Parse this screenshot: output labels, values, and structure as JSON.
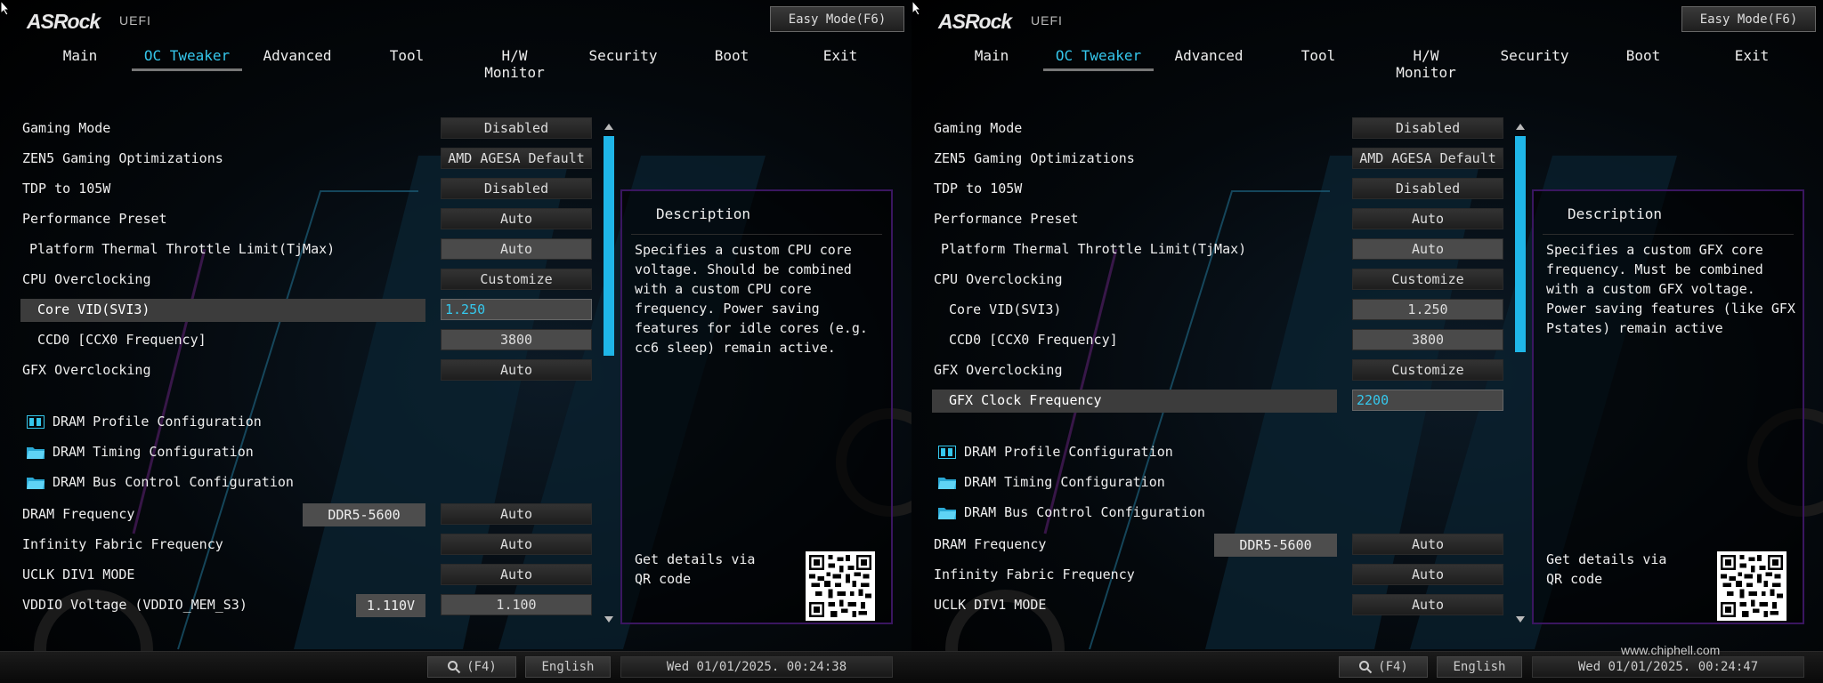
{
  "brand": {
    "logo": "ASRock",
    "sub": "UEFI"
  },
  "easy_mode": "Easy Mode(F6)",
  "tabs": [
    "Main",
    "OC Tweaker",
    "Advanced",
    "Tool",
    "H/W Monitor",
    "Security",
    "Boot",
    "Exit"
  ],
  "active_tab": "OC Tweaker",
  "footer": {
    "search": "(F4)",
    "language": "English"
  },
  "colors": {
    "accent": "#35c7ec",
    "scroll": "#1fb6e8",
    "desc_border": "#3a1660"
  },
  "left": {
    "rows": {
      "gaming_mode": {
        "label": "Gaming Mode",
        "value": "Disabled"
      },
      "zen5": {
        "label": "ZEN5 Gaming Optimizations",
        "value": "AMD AGESA Default"
      },
      "tdp": {
        "label": "TDP to 105W",
        "value": "Disabled"
      },
      "perf_preset": {
        "label": "Performance Preset",
        "value": "Auto"
      },
      "ptt": {
        "label": "Platform Thermal Throttle Limit(TjMax)",
        "value": "Auto"
      },
      "cpu_oc": {
        "label": "CPU Overclocking",
        "value": "Customize"
      },
      "core_vid": {
        "label": "Core VID(SVI3)",
        "value": "1.250"
      },
      "ccd0": {
        "label": "CCD0 [CCX0 Frequency]",
        "value": "3800"
      },
      "gfx_oc": {
        "label": "GFX Overclocking",
        "value": "Auto"
      },
      "dram_profile": {
        "label": "DRAM Profile Configuration"
      },
      "dram_timing": {
        "label": "DRAM Timing Configuration"
      },
      "dram_bus": {
        "label": "DRAM Bus Control Configuration"
      },
      "dram_freq": {
        "label": "DRAM Frequency",
        "extra": "DDR5-5600",
        "value": "Auto"
      },
      "if_freq": {
        "label": "Infinity Fabric Frequency",
        "value": "Auto"
      },
      "uclk": {
        "label": "UCLK DIV1 MODE",
        "value": "Auto"
      },
      "vddio": {
        "label": "VDDIO Voltage (VDDIO_MEM_S3)",
        "extra": "1.110V",
        "value": "1.100"
      }
    },
    "description": {
      "title": "Description",
      "text": "Specifies a custom CPU core voltage. Should be combined with a custom CPU core frequency. Power saving features for idle cores (e.g. cc6 sleep) remain active.",
      "qr_text": "Get details via QR code"
    },
    "datetime": "Wed 01/01/2025. 00:24:38"
  },
  "right": {
    "rows": {
      "gaming_mode": {
        "label": "Gaming Mode",
        "value": "Disabled"
      },
      "zen5": {
        "label": "ZEN5 Gaming Optimizations",
        "value": "AMD AGESA Default"
      },
      "tdp": {
        "label": "TDP to 105W",
        "value": "Disabled"
      },
      "perf_preset": {
        "label": "Performance Preset",
        "value": "Auto"
      },
      "ptt": {
        "label": "Platform Thermal Throttle Limit(TjMax)",
        "value": "Auto"
      },
      "cpu_oc": {
        "label": "CPU Overclocking",
        "value": "Customize"
      },
      "core_vid": {
        "label": "Core VID(SVI3)",
        "value": "1.250"
      },
      "ccd0": {
        "label": "CCD0 [CCX0 Frequency]",
        "value": "3800"
      },
      "gfx_oc": {
        "label": "GFX Overclocking",
        "value": "Customize"
      },
      "gfx_clock": {
        "label": "GFX Clock Frequency",
        "value": "2200"
      },
      "dram_profile": {
        "label": "DRAM Profile Configuration"
      },
      "dram_timing": {
        "label": "DRAM Timing Configuration"
      },
      "dram_bus": {
        "label": "DRAM Bus Control Configuration"
      },
      "dram_freq": {
        "label": "DRAM Frequency",
        "extra": "DDR5-5600",
        "value": "Auto"
      },
      "if_freq": {
        "label": "Infinity Fabric Frequency",
        "value": "Auto"
      },
      "uclk": {
        "label": "UCLK DIV1 MODE",
        "value": "Auto"
      }
    },
    "description": {
      "title": "Description",
      "text": "Specifies a custom GFX core frequency. Must be combined with a custom GFX voltage. Power saving features (like GFX Pstates) remain active",
      "qr_text": "Get details via QR code"
    },
    "datetime": "Wed 01/01/2025. 00:24:47",
    "watermark": "www.chiphell.com"
  }
}
